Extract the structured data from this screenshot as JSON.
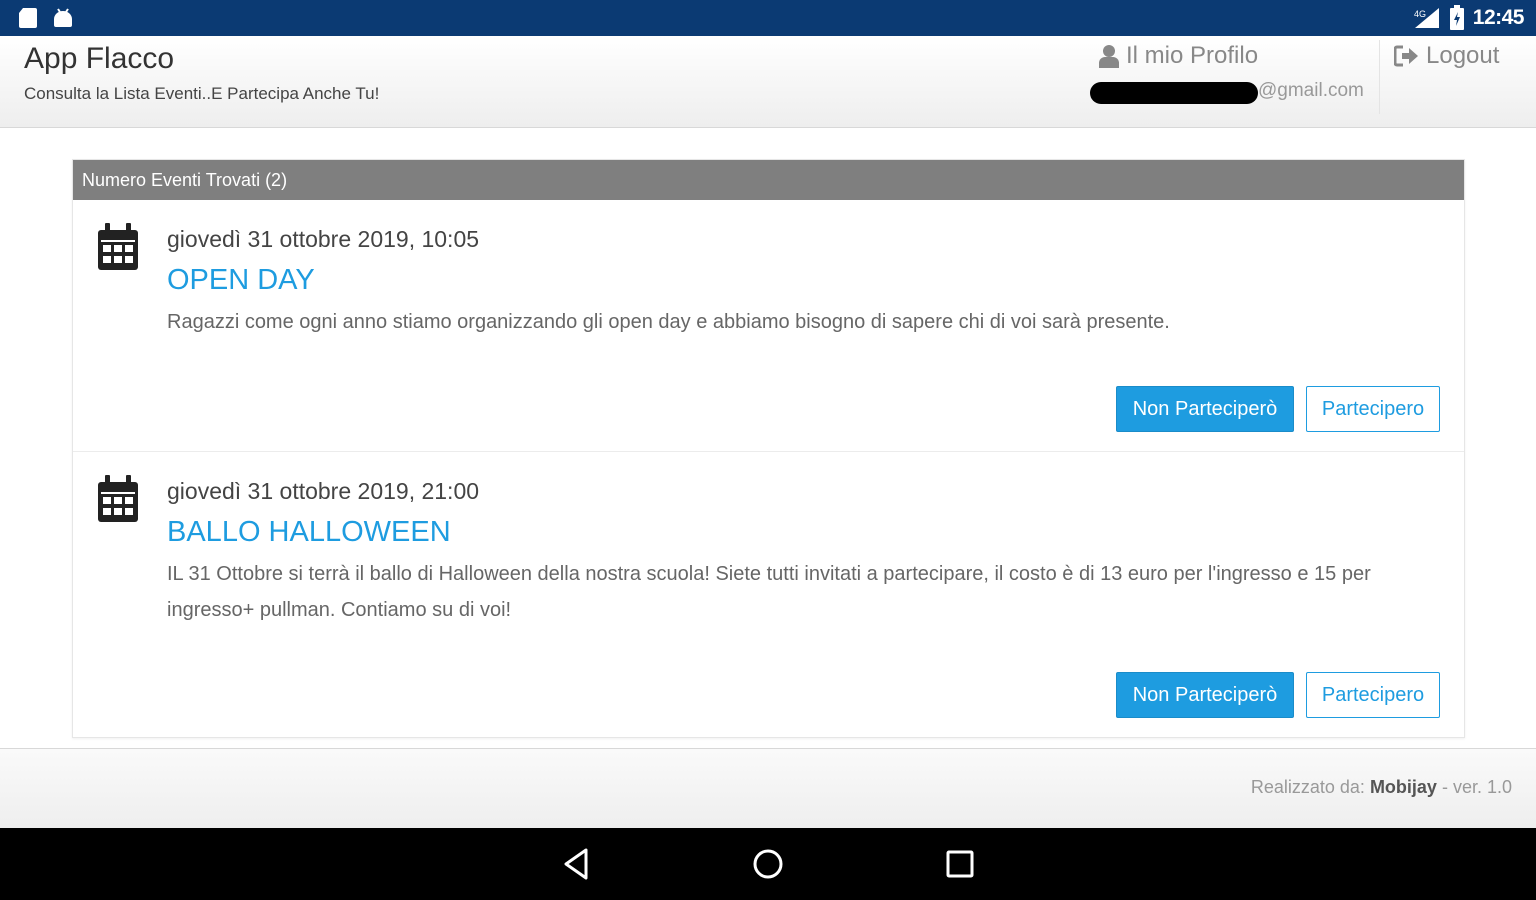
{
  "status_bar": {
    "time": "12:45"
  },
  "header": {
    "title": "App Flacco",
    "subtitle": "Consulta la Lista Eventi..E Partecipa Anche Tu!",
    "profile_label": "Il mio Profilo",
    "email_suffix": "@gmail.com",
    "logout_label": "Logout"
  },
  "panel": {
    "heading": "Numero Eventi Trovati (2)",
    "events": [
      {
        "date": "giovedì 31 ottobre 2019, 10:05",
        "title": "OPEN DAY",
        "description": "Ragazzi come ogni anno stiamo organizzando gli open day e abbiamo bisogno di sapere chi di voi sarà presente.",
        "decline_label": "Non Parteciperò",
        "accept_label": "Partecipero"
      },
      {
        "date": "giovedì 31 ottobre 2019, 21:00",
        "title": "BALLO HALLOWEEN",
        "description": "IL 31 Ottobre si terrà il ballo di Halloween della nostra scuola! Siete tutti invitati a partecipare, il costo è di 13 euro per l'ingresso e 15 per ingresso+ pullman. Contiamo su di voi!",
        "decline_label": "Non Parteciperò",
        "accept_label": "Partecipero"
      }
    ]
  },
  "footer": {
    "prefix": "Realizzato da: ",
    "brand": "Mobijay",
    "version": " - ver. 1.0"
  },
  "colors": {
    "status_bar": "#0b3a73",
    "accent": "#1e9ce0",
    "panel_heading": "#7f7f7f"
  },
  "icons": {
    "status_left": [
      "sd-card-icon",
      "android-icon"
    ],
    "status_right": [
      "signal-icon",
      "battery-icon"
    ],
    "profile": "user-icon",
    "logout": "logout-icon",
    "event": "calendar-icon",
    "nav": [
      "back-icon",
      "home-icon",
      "recents-icon"
    ]
  }
}
